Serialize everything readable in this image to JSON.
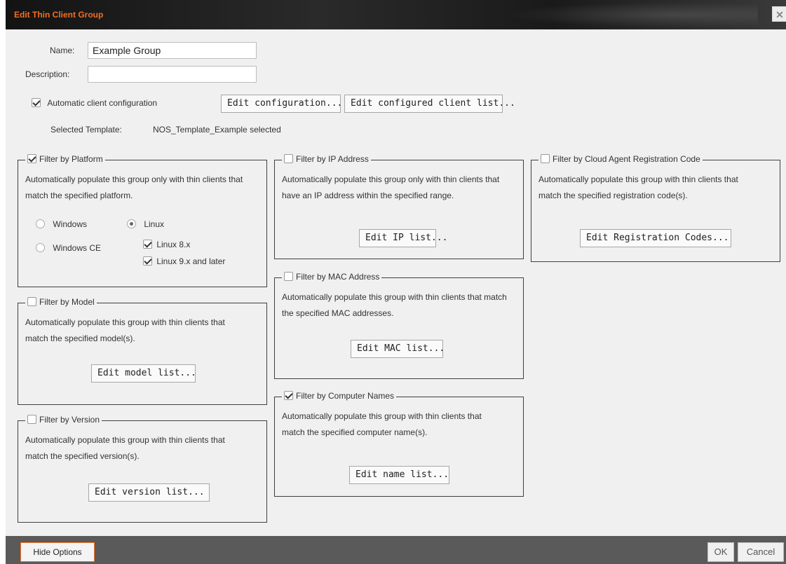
{
  "dialog": {
    "title": "Edit Thin Client Group",
    "close_glyph": "✕"
  },
  "form": {
    "name_label": "Name:",
    "name_value": "Example Group",
    "description_label": "Description:",
    "description_value": "",
    "auto_config_label": "Automatic client configuration",
    "auto_config_checked": true,
    "edit_configuration_label": "Edit configuration...",
    "edit_client_list_label": "Edit configured client list...",
    "selected_template_label": "Selected Template:",
    "selected_template_value": "NOS_Template_Example selected"
  },
  "filters": {
    "platform": {
      "title": "Filter by Platform",
      "checked": true,
      "desc": "Automatically populate this group only with thin clients that match the specified platform.",
      "windows": "Windows",
      "linux": "Linux",
      "windows_ce": "Windows CE",
      "linux8": "Linux 8.x",
      "linux9": "Linux 9.x and later",
      "selected": "Linux"
    },
    "model": {
      "title": "Filter by Model",
      "checked": false,
      "desc": "Automatically populate this group with thin clients that match the specified model(s).",
      "button": "Edit model list..."
    },
    "version": {
      "title": "Filter by Version",
      "checked": false,
      "desc": "Automatically populate this group with thin clients that match the specified version(s).",
      "button": "Edit version list..."
    },
    "ip": {
      "title": "Filter by IP Address",
      "checked": false,
      "desc": "Automatically populate this group only with thin clients that have an IP address within the specified range.",
      "button": "Edit IP list..."
    },
    "mac": {
      "title": "Filter by MAC Address",
      "checked": false,
      "desc": "Automatically populate this group with thin clients that match the specified MAC addresses.",
      "button": "Edit MAC list..."
    },
    "names": {
      "title": "Filter by Computer Names",
      "checked": true,
      "desc": "Automatically populate this group with thin clients that match the specified computer name(s).",
      "button": "Edit name list..."
    },
    "cloud": {
      "title": "Filter by Cloud Agent Registration Code",
      "checked": false,
      "desc": "Automatically populate this group with thin clients that match the specified registration code(s).",
      "button": "Edit Registration Codes..."
    }
  },
  "footer": {
    "hide_options": "Hide Options",
    "ok": "OK",
    "cancel": "Cancel"
  },
  "colors": {
    "accent": "#f36f21",
    "footer_bg": "#5a5a5a",
    "dialog_bg": "#f0f0f0"
  }
}
